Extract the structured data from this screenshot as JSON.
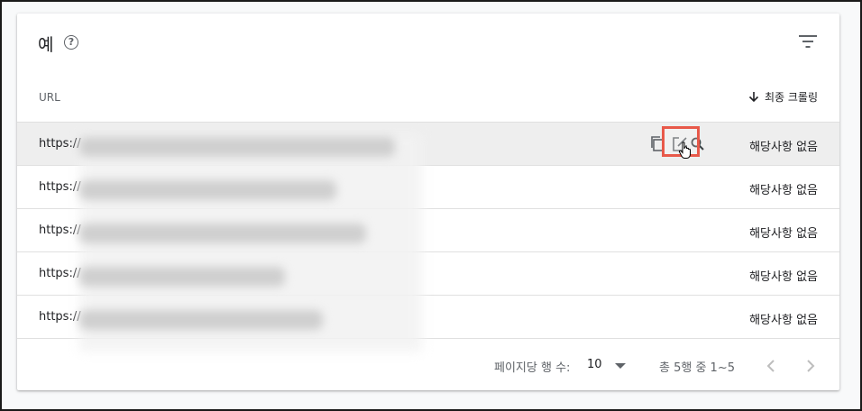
{
  "header": {
    "title": "예",
    "help_icon": "help-circle-icon",
    "filter_icon": "filter-list-icon"
  },
  "columns": {
    "url": "URL",
    "last_crawl": "최종 크롤링",
    "sort_icon": "arrow-down-icon"
  },
  "rows": [
    {
      "url": "https://",
      "status": "해당사항 없음"
    },
    {
      "url": "https://",
      "status": "해당사항 없음"
    },
    {
      "url": "https://",
      "status": "해당사항 없음"
    },
    {
      "url": "https://",
      "status": "해당사항 없음"
    },
    {
      "url": "https://",
      "status": "해당사항 없음"
    }
  ],
  "row_actions": [
    "copy-icon",
    "open-external-icon",
    "search-icon"
  ],
  "footer": {
    "rows_per_page_label": "페이지당 행 수:",
    "rows_per_page_value": "10",
    "range_text": "총 5행 중 1~5"
  },
  "colors": {
    "highlight": "#e8594a",
    "hover_row": "#eeeeee"
  }
}
